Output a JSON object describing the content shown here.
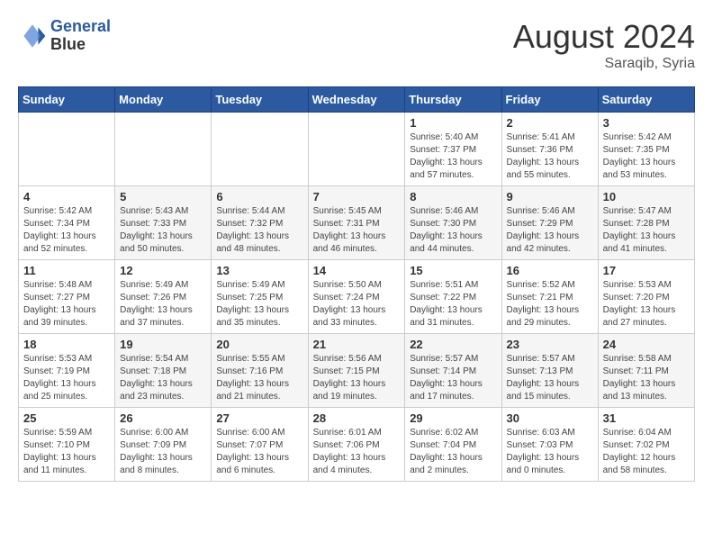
{
  "header": {
    "logo_line1": "General",
    "logo_line2": "Blue",
    "month_year": "August 2024",
    "location": "Saraqib, Syria"
  },
  "days_of_week": [
    "Sunday",
    "Monday",
    "Tuesday",
    "Wednesday",
    "Thursday",
    "Friday",
    "Saturday"
  ],
  "weeks": [
    [
      {
        "day": "",
        "info": ""
      },
      {
        "day": "",
        "info": ""
      },
      {
        "day": "",
        "info": ""
      },
      {
        "day": "",
        "info": ""
      },
      {
        "day": "1",
        "info": "Sunrise: 5:40 AM\nSunset: 7:37 PM\nDaylight: 13 hours\nand 57 minutes."
      },
      {
        "day": "2",
        "info": "Sunrise: 5:41 AM\nSunset: 7:36 PM\nDaylight: 13 hours\nand 55 minutes."
      },
      {
        "day": "3",
        "info": "Sunrise: 5:42 AM\nSunset: 7:35 PM\nDaylight: 13 hours\nand 53 minutes."
      }
    ],
    [
      {
        "day": "4",
        "info": "Sunrise: 5:42 AM\nSunset: 7:34 PM\nDaylight: 13 hours\nand 52 minutes."
      },
      {
        "day": "5",
        "info": "Sunrise: 5:43 AM\nSunset: 7:33 PM\nDaylight: 13 hours\nand 50 minutes."
      },
      {
        "day": "6",
        "info": "Sunrise: 5:44 AM\nSunset: 7:32 PM\nDaylight: 13 hours\nand 48 minutes."
      },
      {
        "day": "7",
        "info": "Sunrise: 5:45 AM\nSunset: 7:31 PM\nDaylight: 13 hours\nand 46 minutes."
      },
      {
        "day": "8",
        "info": "Sunrise: 5:46 AM\nSunset: 7:30 PM\nDaylight: 13 hours\nand 44 minutes."
      },
      {
        "day": "9",
        "info": "Sunrise: 5:46 AM\nSunset: 7:29 PM\nDaylight: 13 hours\nand 42 minutes."
      },
      {
        "day": "10",
        "info": "Sunrise: 5:47 AM\nSunset: 7:28 PM\nDaylight: 13 hours\nand 41 minutes."
      }
    ],
    [
      {
        "day": "11",
        "info": "Sunrise: 5:48 AM\nSunset: 7:27 PM\nDaylight: 13 hours\nand 39 minutes."
      },
      {
        "day": "12",
        "info": "Sunrise: 5:49 AM\nSunset: 7:26 PM\nDaylight: 13 hours\nand 37 minutes."
      },
      {
        "day": "13",
        "info": "Sunrise: 5:49 AM\nSunset: 7:25 PM\nDaylight: 13 hours\nand 35 minutes."
      },
      {
        "day": "14",
        "info": "Sunrise: 5:50 AM\nSunset: 7:24 PM\nDaylight: 13 hours\nand 33 minutes."
      },
      {
        "day": "15",
        "info": "Sunrise: 5:51 AM\nSunset: 7:22 PM\nDaylight: 13 hours\nand 31 minutes."
      },
      {
        "day": "16",
        "info": "Sunrise: 5:52 AM\nSunset: 7:21 PM\nDaylight: 13 hours\nand 29 minutes."
      },
      {
        "day": "17",
        "info": "Sunrise: 5:53 AM\nSunset: 7:20 PM\nDaylight: 13 hours\nand 27 minutes."
      }
    ],
    [
      {
        "day": "18",
        "info": "Sunrise: 5:53 AM\nSunset: 7:19 PM\nDaylight: 13 hours\nand 25 minutes."
      },
      {
        "day": "19",
        "info": "Sunrise: 5:54 AM\nSunset: 7:18 PM\nDaylight: 13 hours\nand 23 minutes."
      },
      {
        "day": "20",
        "info": "Sunrise: 5:55 AM\nSunset: 7:16 PM\nDaylight: 13 hours\nand 21 minutes."
      },
      {
        "day": "21",
        "info": "Sunrise: 5:56 AM\nSunset: 7:15 PM\nDaylight: 13 hours\nand 19 minutes."
      },
      {
        "day": "22",
        "info": "Sunrise: 5:57 AM\nSunset: 7:14 PM\nDaylight: 13 hours\nand 17 minutes."
      },
      {
        "day": "23",
        "info": "Sunrise: 5:57 AM\nSunset: 7:13 PM\nDaylight: 13 hours\nand 15 minutes."
      },
      {
        "day": "24",
        "info": "Sunrise: 5:58 AM\nSunset: 7:11 PM\nDaylight: 13 hours\nand 13 minutes."
      }
    ],
    [
      {
        "day": "25",
        "info": "Sunrise: 5:59 AM\nSunset: 7:10 PM\nDaylight: 13 hours\nand 11 minutes."
      },
      {
        "day": "26",
        "info": "Sunrise: 6:00 AM\nSunset: 7:09 PM\nDaylight: 13 hours\nand 8 minutes."
      },
      {
        "day": "27",
        "info": "Sunrise: 6:00 AM\nSunset: 7:07 PM\nDaylight: 13 hours\nand 6 minutes."
      },
      {
        "day": "28",
        "info": "Sunrise: 6:01 AM\nSunset: 7:06 PM\nDaylight: 13 hours\nand 4 minutes."
      },
      {
        "day": "29",
        "info": "Sunrise: 6:02 AM\nSunset: 7:04 PM\nDaylight: 13 hours\nand 2 minutes."
      },
      {
        "day": "30",
        "info": "Sunrise: 6:03 AM\nSunset: 7:03 PM\nDaylight: 13 hours\nand 0 minutes."
      },
      {
        "day": "31",
        "info": "Sunrise: 6:04 AM\nSunset: 7:02 PM\nDaylight: 12 hours\nand 58 minutes."
      }
    ]
  ]
}
